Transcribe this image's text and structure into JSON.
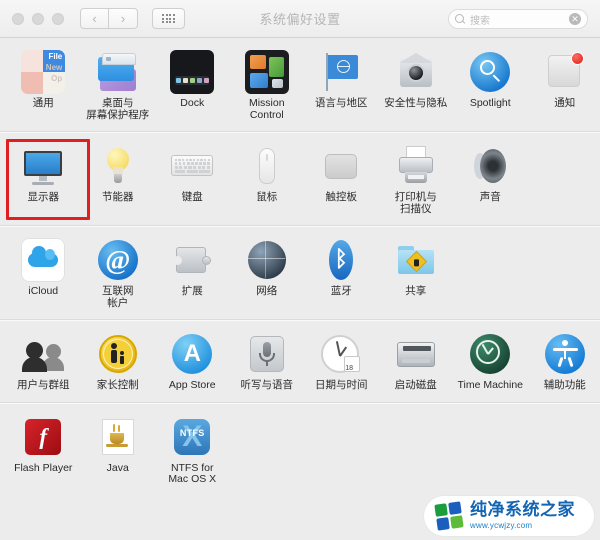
{
  "window": {
    "title": "系统偏好设置",
    "traffic_lights": [
      "close",
      "minimize",
      "zoom"
    ],
    "nav": {
      "back_label": "‹",
      "forward_label": "›"
    },
    "show_all_label": "show-all-grid"
  },
  "search": {
    "placeholder": "搜索",
    "value": "",
    "clear_label": "✕"
  },
  "selection": {
    "selected_pane": "显示器",
    "highlight_color": "#e02020"
  },
  "groups": [
    {
      "name": "personal",
      "panes": [
        {
          "label": "通用",
          "icon": "general-icon"
        },
        {
          "label": "桌面与\n屏幕保护程序",
          "icon": "desktop-screensaver-icon"
        },
        {
          "label": "Dock",
          "icon": "dock-icon"
        },
        {
          "label": "Mission\nControl",
          "icon": "mission-control-icon"
        },
        {
          "label": "语言与地区",
          "icon": "language-region-icon"
        },
        {
          "label": "安全性与隐私",
          "icon": "security-privacy-icon"
        },
        {
          "label": "Spotlight",
          "icon": "spotlight-icon"
        },
        {
          "label": "通知",
          "icon": "notifications-icon"
        }
      ]
    },
    {
      "name": "hardware",
      "panes": [
        {
          "label": "显示器",
          "icon": "displays-icon"
        },
        {
          "label": "节能器",
          "icon": "energy-saver-icon"
        },
        {
          "label": "键盘",
          "icon": "keyboard-icon"
        },
        {
          "label": "鼠标",
          "icon": "mouse-icon"
        },
        {
          "label": "触控板",
          "icon": "trackpad-icon"
        },
        {
          "label": "打印机与\n扫描仪",
          "icon": "printers-scanners-icon"
        },
        {
          "label": "声音",
          "icon": "sound-icon"
        }
      ]
    },
    {
      "name": "internet-wireless",
      "panes": [
        {
          "label": "iCloud",
          "icon": "icloud-icon"
        },
        {
          "label": "互联网\n帐户",
          "icon": "internet-accounts-icon"
        },
        {
          "label": "扩展",
          "icon": "extensions-icon"
        },
        {
          "label": "网络",
          "icon": "network-icon"
        },
        {
          "label": "蓝牙",
          "icon": "bluetooth-icon"
        },
        {
          "label": "共享",
          "icon": "sharing-icon"
        }
      ]
    },
    {
      "name": "system",
      "panes": [
        {
          "label": "用户与群组",
          "icon": "users-groups-icon"
        },
        {
          "label": "家长控制",
          "icon": "parental-controls-icon"
        },
        {
          "label": "App Store",
          "icon": "app-store-icon"
        },
        {
          "label": "听写与语音",
          "icon": "dictation-speech-icon"
        },
        {
          "label": "日期与时间",
          "icon": "date-time-icon"
        },
        {
          "label": "启动磁盘",
          "icon": "startup-disk-icon"
        },
        {
          "label": "Time Machine",
          "icon": "time-machine-icon"
        },
        {
          "label": "辅助功能",
          "icon": "accessibility-icon"
        }
      ]
    },
    {
      "name": "other",
      "panes": [
        {
          "label": "Flash Player",
          "icon": "flash-player-icon"
        },
        {
          "label": "Java",
          "icon": "java-icon"
        },
        {
          "label": "NTFS for\nMac OS X",
          "icon": "ntfs-mac-icon"
        }
      ]
    }
  ],
  "watermark": {
    "title": "纯净系统之家",
    "url": "www.ycwjzy.com"
  },
  "icon_glyphs": {
    "internet_accounts": "@",
    "bluetooth": "ᛒ",
    "app_store": "A",
    "flash": "f",
    "ntfs": "NTFS",
    "ntfs_x": "X",
    "date_day": "18"
  }
}
